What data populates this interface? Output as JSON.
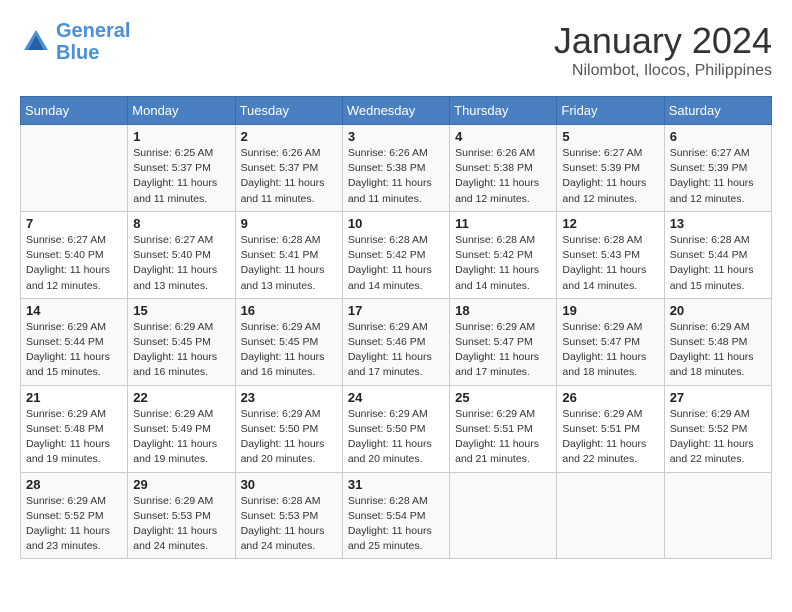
{
  "header": {
    "logo_line1": "General",
    "logo_line2": "Blue",
    "month": "January 2024",
    "location": "Nilombot, Ilocos, Philippines"
  },
  "columns": [
    "Sunday",
    "Monday",
    "Tuesday",
    "Wednesday",
    "Thursday",
    "Friday",
    "Saturday"
  ],
  "weeks": [
    [
      {
        "day": "",
        "info": ""
      },
      {
        "day": "1",
        "info": "Sunrise: 6:25 AM\nSunset: 5:37 PM\nDaylight: 11 hours\nand 11 minutes."
      },
      {
        "day": "2",
        "info": "Sunrise: 6:26 AM\nSunset: 5:37 PM\nDaylight: 11 hours\nand 11 minutes."
      },
      {
        "day": "3",
        "info": "Sunrise: 6:26 AM\nSunset: 5:38 PM\nDaylight: 11 hours\nand 11 minutes."
      },
      {
        "day": "4",
        "info": "Sunrise: 6:26 AM\nSunset: 5:38 PM\nDaylight: 11 hours\nand 12 minutes."
      },
      {
        "day": "5",
        "info": "Sunrise: 6:27 AM\nSunset: 5:39 PM\nDaylight: 11 hours\nand 12 minutes."
      },
      {
        "day": "6",
        "info": "Sunrise: 6:27 AM\nSunset: 5:39 PM\nDaylight: 11 hours\nand 12 minutes."
      }
    ],
    [
      {
        "day": "7",
        "info": "Sunrise: 6:27 AM\nSunset: 5:40 PM\nDaylight: 11 hours\nand 12 minutes."
      },
      {
        "day": "8",
        "info": "Sunrise: 6:27 AM\nSunset: 5:40 PM\nDaylight: 11 hours\nand 13 minutes."
      },
      {
        "day": "9",
        "info": "Sunrise: 6:28 AM\nSunset: 5:41 PM\nDaylight: 11 hours\nand 13 minutes."
      },
      {
        "day": "10",
        "info": "Sunrise: 6:28 AM\nSunset: 5:42 PM\nDaylight: 11 hours\nand 14 minutes."
      },
      {
        "day": "11",
        "info": "Sunrise: 6:28 AM\nSunset: 5:42 PM\nDaylight: 11 hours\nand 14 minutes."
      },
      {
        "day": "12",
        "info": "Sunrise: 6:28 AM\nSunset: 5:43 PM\nDaylight: 11 hours\nand 14 minutes."
      },
      {
        "day": "13",
        "info": "Sunrise: 6:28 AM\nSunset: 5:44 PM\nDaylight: 11 hours\nand 15 minutes."
      }
    ],
    [
      {
        "day": "14",
        "info": "Sunrise: 6:29 AM\nSunset: 5:44 PM\nDaylight: 11 hours\nand 15 minutes."
      },
      {
        "day": "15",
        "info": "Sunrise: 6:29 AM\nSunset: 5:45 PM\nDaylight: 11 hours\nand 16 minutes."
      },
      {
        "day": "16",
        "info": "Sunrise: 6:29 AM\nSunset: 5:45 PM\nDaylight: 11 hours\nand 16 minutes."
      },
      {
        "day": "17",
        "info": "Sunrise: 6:29 AM\nSunset: 5:46 PM\nDaylight: 11 hours\nand 17 minutes."
      },
      {
        "day": "18",
        "info": "Sunrise: 6:29 AM\nSunset: 5:47 PM\nDaylight: 11 hours\nand 17 minutes."
      },
      {
        "day": "19",
        "info": "Sunrise: 6:29 AM\nSunset: 5:47 PM\nDaylight: 11 hours\nand 18 minutes."
      },
      {
        "day": "20",
        "info": "Sunrise: 6:29 AM\nSunset: 5:48 PM\nDaylight: 11 hours\nand 18 minutes."
      }
    ],
    [
      {
        "day": "21",
        "info": "Sunrise: 6:29 AM\nSunset: 5:48 PM\nDaylight: 11 hours\nand 19 minutes."
      },
      {
        "day": "22",
        "info": "Sunrise: 6:29 AM\nSunset: 5:49 PM\nDaylight: 11 hours\nand 19 minutes."
      },
      {
        "day": "23",
        "info": "Sunrise: 6:29 AM\nSunset: 5:50 PM\nDaylight: 11 hours\nand 20 minutes."
      },
      {
        "day": "24",
        "info": "Sunrise: 6:29 AM\nSunset: 5:50 PM\nDaylight: 11 hours\nand 20 minutes."
      },
      {
        "day": "25",
        "info": "Sunrise: 6:29 AM\nSunset: 5:51 PM\nDaylight: 11 hours\nand 21 minutes."
      },
      {
        "day": "26",
        "info": "Sunrise: 6:29 AM\nSunset: 5:51 PM\nDaylight: 11 hours\nand 22 minutes."
      },
      {
        "day": "27",
        "info": "Sunrise: 6:29 AM\nSunset: 5:52 PM\nDaylight: 11 hours\nand 22 minutes."
      }
    ],
    [
      {
        "day": "28",
        "info": "Sunrise: 6:29 AM\nSunset: 5:52 PM\nDaylight: 11 hours\nand 23 minutes."
      },
      {
        "day": "29",
        "info": "Sunrise: 6:29 AM\nSunset: 5:53 PM\nDaylight: 11 hours\nand 24 minutes."
      },
      {
        "day": "30",
        "info": "Sunrise: 6:28 AM\nSunset: 5:53 PM\nDaylight: 11 hours\nand 24 minutes."
      },
      {
        "day": "31",
        "info": "Sunrise: 6:28 AM\nSunset: 5:54 PM\nDaylight: 11 hours\nand 25 minutes."
      },
      {
        "day": "",
        "info": ""
      },
      {
        "day": "",
        "info": ""
      },
      {
        "day": "",
        "info": ""
      }
    ]
  ]
}
